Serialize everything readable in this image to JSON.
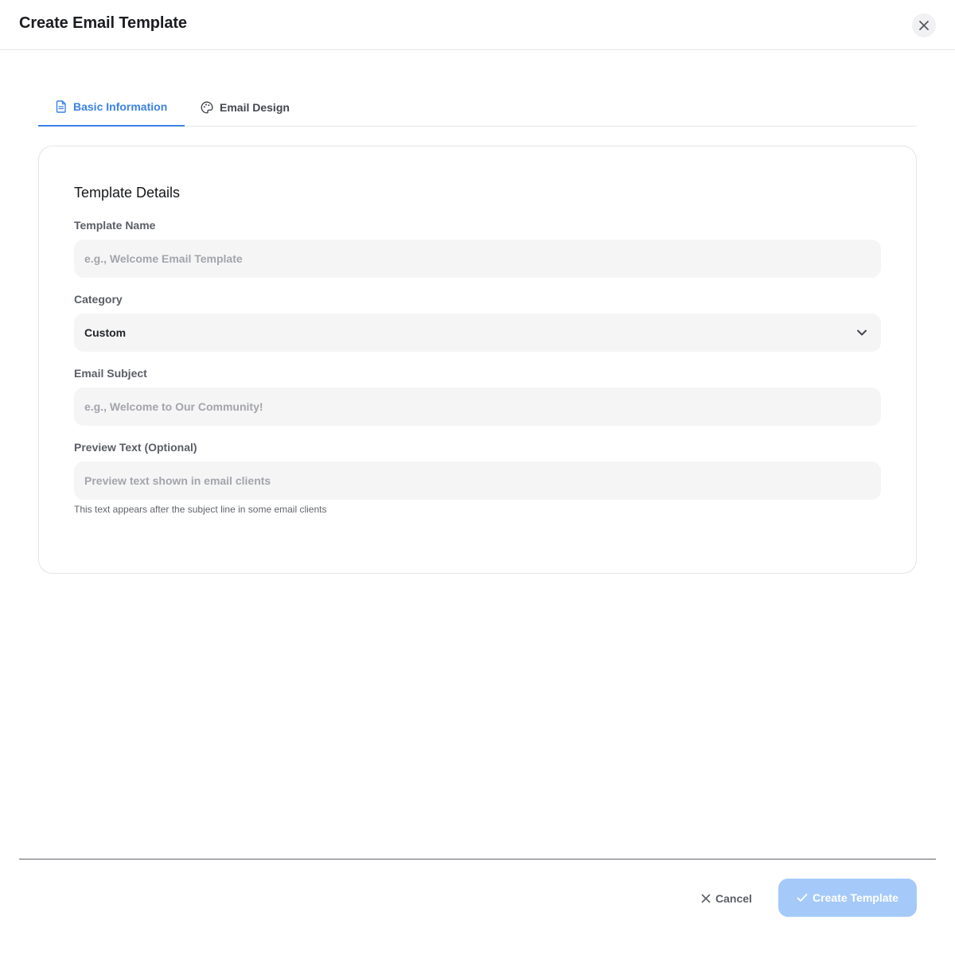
{
  "header": {
    "title": "Create Email Template",
    "close_icon": "close-icon"
  },
  "tabs": [
    {
      "label": "Basic Information",
      "icon": "document-icon",
      "active": true
    },
    {
      "label": "Email Design",
      "icon": "palette-icon",
      "active": false
    }
  ],
  "card": {
    "section_title": "Template Details",
    "fields": {
      "template_name": {
        "label": "Template Name",
        "value": "",
        "placeholder": "e.g., Welcome Email Template"
      },
      "category": {
        "label": "Category",
        "value": "Custom"
      },
      "email_subject": {
        "label": "Email Subject",
        "value": "",
        "placeholder": "e.g., Welcome to Our Community!"
      },
      "preview_text": {
        "label": "Preview Text (Optional)",
        "value": "",
        "placeholder": "Preview text shown in email clients",
        "hint": "This text appears after the subject line in some email clients"
      }
    }
  },
  "footer": {
    "cancel_label": "Cancel",
    "create_label": "Create Template"
  },
  "colors": {
    "accent": "#3b82e6",
    "primary_disabled": "#a5caf9",
    "field_bg": "#f5f5f6"
  }
}
